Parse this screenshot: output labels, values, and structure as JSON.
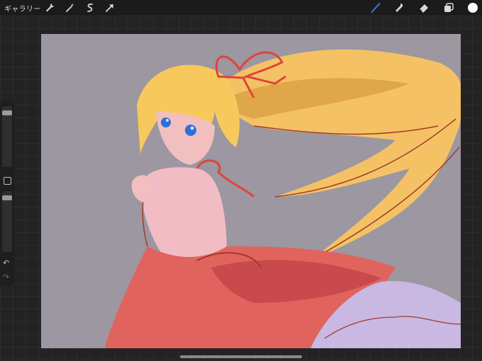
{
  "topbar": {
    "gallery_label": "ギャラリー",
    "left_tools": [
      "wrench-icon",
      "magic-wand-icon",
      "selection-icon",
      "transform-arrow-icon"
    ],
    "right_tools": [
      "brush-icon",
      "smudge-icon",
      "eraser-icon",
      "layers-icon",
      "color-swatch-icon"
    ],
    "active_tool": "brush",
    "active_color": "#2f6fd6",
    "current_color": "#ffffff"
  },
  "sidebar": {
    "brush_size": 0.1,
    "opacity": 0.05
  },
  "canvas": {
    "background_color": "#9c97a0"
  }
}
